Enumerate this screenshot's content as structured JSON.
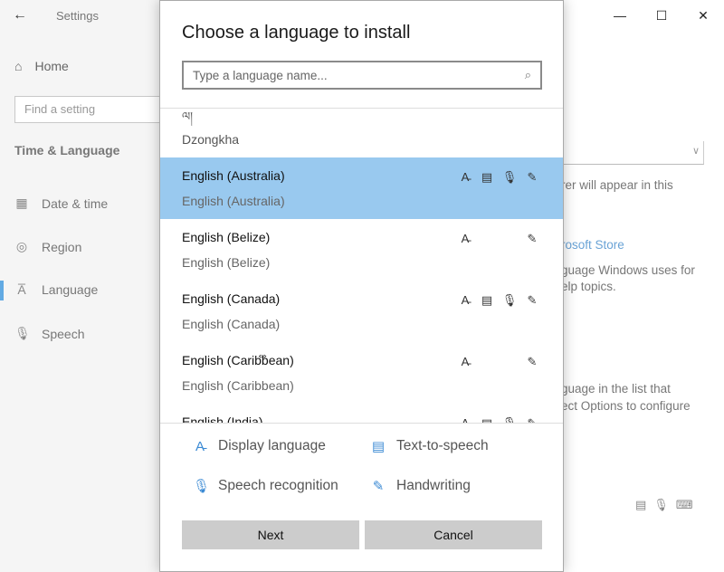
{
  "settings": {
    "title": "Settings",
    "back_icon": "back-arrow-icon",
    "window_controls": [
      "minimize-icon",
      "maximize-icon",
      "close-icon"
    ],
    "home_label": "Home",
    "find_placeholder": "Find a setting",
    "section": "Time & Language",
    "nav": [
      {
        "label": "Date & time",
        "icon": "calendar-clock-icon"
      },
      {
        "label": "Region",
        "icon": "globe-icon"
      },
      {
        "label": "Language",
        "icon": "language-icon"
      },
      {
        "label": "Speech",
        "icon": "microphone-icon"
      }
    ],
    "right_fragments": {
      "f1": "rer will appear in this",
      "f2": "rosoft Store",
      "f3": "guage Windows uses for",
      "f4": "elp topics.",
      "f5": "guage in the list that",
      "f6": "ect Options to configure"
    }
  },
  "dialog": {
    "title": "Choose a language to install",
    "search_placeholder": "Type a language name...",
    "list_fragment_top": "ལ།",
    "dzongkha": "Dzongkha",
    "items": [
      {
        "name": "English (Australia)",
        "native": "English (Australia)",
        "selected": true,
        "features": [
          "display",
          "tts",
          "speech",
          "handwriting"
        ]
      },
      {
        "name": "English (Belize)",
        "native": "English (Belize)",
        "selected": false,
        "features": [
          "display",
          "handwriting"
        ]
      },
      {
        "name": "English (Canada)",
        "native": "English (Canada)",
        "selected": false,
        "features": [
          "display",
          "tts",
          "speech",
          "handwriting"
        ]
      },
      {
        "name": "English (Caribbean)",
        "native": "English (Caribbean)",
        "selected": false,
        "features": [
          "display",
          "handwriting"
        ]
      },
      {
        "name": "English (India)",
        "native": "",
        "selected": false,
        "features": [
          "display",
          "tts",
          "speech",
          "handwriting"
        ]
      }
    ],
    "legend": {
      "display": "Display language",
      "tts": "Text-to-speech",
      "speech": "Speech recognition",
      "handwriting": "Handwriting"
    },
    "buttons": {
      "next": "Next",
      "cancel": "Cancel"
    },
    "colors": {
      "selected_row": "#99c9ef",
      "legend_icon": "#3b8ad4",
      "button_bg": "#cccccc"
    }
  }
}
